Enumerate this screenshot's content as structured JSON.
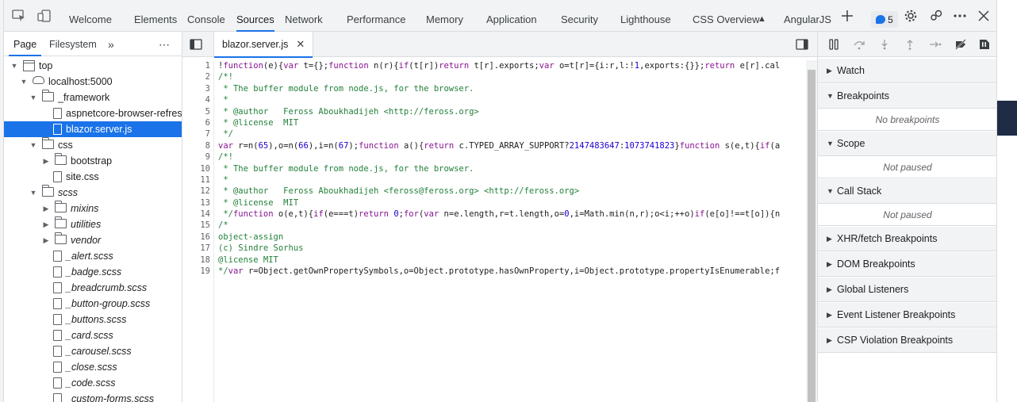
{
  "toolbar": {
    "tabs": [
      "Welcome",
      "Elements",
      "Console",
      "Sources",
      "Network",
      "Performance",
      "Memory",
      "Application",
      "Security",
      "Lighthouse",
      "CSS Overview",
      "AngularJS"
    ],
    "selected_tab": "Sources",
    "issues_count": "5",
    "accent": "#1a73e8"
  },
  "navigator": {
    "tabs": [
      "Page",
      "Filesystem"
    ],
    "selected_tab": "Page",
    "tree": [
      {
        "label": "top",
        "depth": 0,
        "kind": "frame",
        "expanded": true
      },
      {
        "label": "localhost:5000",
        "depth": 1,
        "kind": "cloud",
        "expanded": true
      },
      {
        "label": "_framework",
        "depth": 2,
        "kind": "folder",
        "expanded": true
      },
      {
        "label": "aspnetcore-browser-refresh",
        "depth": 3,
        "kind": "file"
      },
      {
        "label": "blazor.server.js",
        "depth": 3,
        "kind": "file",
        "selected": true
      },
      {
        "label": "css",
        "depth": 2,
        "kind": "folder",
        "expanded": true
      },
      {
        "label": "bootstrap",
        "depth": 3,
        "kind": "folder",
        "expanded": false
      },
      {
        "label": "site.css",
        "depth": 3,
        "kind": "file"
      },
      {
        "label": "scss",
        "depth": 2,
        "kind": "folder",
        "expanded": true,
        "italic": true
      },
      {
        "label": "mixins",
        "depth": 3,
        "kind": "folder",
        "expanded": false,
        "italic": true
      },
      {
        "label": "utilities",
        "depth": 3,
        "kind": "folder",
        "expanded": false,
        "italic": true
      },
      {
        "label": "vendor",
        "depth": 3,
        "kind": "folder",
        "expanded": false,
        "italic": true
      },
      {
        "label": "_alert.scss",
        "depth": 3,
        "kind": "file",
        "italic": true
      },
      {
        "label": "_badge.scss",
        "depth": 3,
        "kind": "file",
        "italic": true
      },
      {
        "label": "_breadcrumb.scss",
        "depth": 3,
        "kind": "file",
        "italic": true
      },
      {
        "label": "_button-group.scss",
        "depth": 3,
        "kind": "file",
        "italic": true
      },
      {
        "label": "_buttons.scss",
        "depth": 3,
        "kind": "file",
        "italic": true
      },
      {
        "label": "_card.scss",
        "depth": 3,
        "kind": "file",
        "italic": true
      },
      {
        "label": "_carousel.scss",
        "depth": 3,
        "kind": "file",
        "italic": true
      },
      {
        "label": "_close.scss",
        "depth": 3,
        "kind": "file",
        "italic": true
      },
      {
        "label": "_code.scss",
        "depth": 3,
        "kind": "file",
        "italic": true
      },
      {
        "label": "_custom-forms.scss",
        "depth": 3,
        "kind": "file",
        "italic": true
      }
    ]
  },
  "editor": {
    "open_file": "blazor.server.js",
    "lines": [
      [
        {
          "t": "!",
          "c": ""
        },
        {
          "t": "function",
          "c": "kw"
        },
        {
          "t": "(e){",
          "c": ""
        },
        {
          "t": "var",
          "c": "kw"
        },
        {
          "t": " t={};",
          "c": ""
        },
        {
          "t": "function",
          "c": "kw"
        },
        {
          "t": " n(r){",
          "c": ""
        },
        {
          "t": "if",
          "c": "kw"
        },
        {
          "t": "(t[r])",
          "c": ""
        },
        {
          "t": "return",
          "c": "kw"
        },
        {
          "t": " t[r].exports;",
          "c": ""
        },
        {
          "t": "var",
          "c": "kw"
        },
        {
          "t": " o=t[r]={i:r,l:!",
          "c": ""
        },
        {
          "t": "1",
          "c": "num"
        },
        {
          "t": ",exports:{}};",
          "c": ""
        },
        {
          "t": "return",
          "c": "kw"
        },
        {
          "t": " e[r].cal",
          "c": ""
        }
      ],
      [
        {
          "t": "/*!",
          "c": "com"
        }
      ],
      [
        {
          "t": " * The buffer module from node.js, for the browser.",
          "c": "com"
        }
      ],
      [
        {
          "t": " *",
          "c": "com"
        }
      ],
      [
        {
          "t": " * @author   Feross Aboukhadijeh <http://feross.org>",
          "c": "com"
        }
      ],
      [
        {
          "t": " * @license  MIT",
          "c": "com"
        }
      ],
      [
        {
          "t": " */",
          "c": "com"
        }
      ],
      [
        {
          "t": "var",
          "c": "kw"
        },
        {
          "t": " r=n(",
          "c": ""
        },
        {
          "t": "65",
          "c": "num"
        },
        {
          "t": "),o=n(",
          "c": ""
        },
        {
          "t": "66",
          "c": "num"
        },
        {
          "t": "),i=n(",
          "c": ""
        },
        {
          "t": "67",
          "c": "num"
        },
        {
          "t": ");",
          "c": ""
        },
        {
          "t": "function",
          "c": "kw"
        },
        {
          "t": " a(){",
          "c": ""
        },
        {
          "t": "return",
          "c": "kw"
        },
        {
          "t": " c.TYPED_ARRAY_SUPPORT?",
          "c": ""
        },
        {
          "t": "2147483647",
          "c": "num"
        },
        {
          "t": ":",
          "c": ""
        },
        {
          "t": "1073741823",
          "c": "num"
        },
        {
          "t": "}",
          "c": ""
        },
        {
          "t": "function",
          "c": "kw"
        },
        {
          "t": " s(e,t){",
          "c": ""
        },
        {
          "t": "if",
          "c": "kw"
        },
        {
          "t": "(a",
          "c": ""
        }
      ],
      [
        {
          "t": "/*!",
          "c": "com"
        }
      ],
      [
        {
          "t": " * The buffer module from node.js, for the browser.",
          "c": "com"
        }
      ],
      [
        {
          "t": " *",
          "c": "com"
        }
      ],
      [
        {
          "t": " * @author   Feross Aboukhadijeh <feross@feross.org> <http://feross.org>",
          "c": "com"
        }
      ],
      [
        {
          "t": " * @license  MIT",
          "c": "com"
        }
      ],
      [
        {
          "t": " */",
          "c": "com"
        },
        {
          "t": "function",
          "c": "kw"
        },
        {
          "t": " o(e,t){",
          "c": ""
        },
        {
          "t": "if",
          "c": "kw"
        },
        {
          "t": "(e===t)",
          "c": ""
        },
        {
          "t": "return",
          "c": "kw"
        },
        {
          "t": " ",
          "c": ""
        },
        {
          "t": "0",
          "c": "num"
        },
        {
          "t": ";",
          "c": ""
        },
        {
          "t": "for",
          "c": "kw"
        },
        {
          "t": "(",
          "c": ""
        },
        {
          "t": "var",
          "c": "kw"
        },
        {
          "t": " n=e.length,r=t.length,o=",
          "c": ""
        },
        {
          "t": "0",
          "c": "num"
        },
        {
          "t": ",i=Math.min(n,r);o<i;++o)",
          "c": ""
        },
        {
          "t": "if",
          "c": "kw"
        },
        {
          "t": "(e[o]!==t[o]){n",
          "c": ""
        }
      ],
      [
        {
          "t": "/*",
          "c": "com"
        }
      ],
      [
        {
          "t": "object-assign",
          "c": "com"
        }
      ],
      [
        {
          "t": "(c) Sindre Sorhus",
          "c": "com"
        }
      ],
      [
        {
          "t": "@license MIT",
          "c": "com"
        }
      ],
      [
        {
          "t": "*/",
          "c": "com"
        },
        {
          "t": "var",
          "c": "kw"
        },
        {
          "t": " r=Object.getOwnPropertySymbols,o=Object.prototype.hasOwnProperty,i=Object.prototype.propertyIsEnumerable;f",
          "c": ""
        }
      ]
    ]
  },
  "debugger": {
    "sections": [
      {
        "title": "Watch",
        "expanded": false
      },
      {
        "title": "Breakpoints",
        "expanded": true,
        "body": "No breakpoints"
      },
      {
        "title": "Scope",
        "expanded": true,
        "body": "Not paused"
      },
      {
        "title": "Call Stack",
        "expanded": true,
        "body": "Not paused"
      },
      {
        "title": "XHR/fetch Breakpoints",
        "expanded": false
      },
      {
        "title": "DOM Breakpoints",
        "expanded": false
      },
      {
        "title": "Global Listeners",
        "expanded": false
      },
      {
        "title": "Event Listener Breakpoints",
        "expanded": false
      },
      {
        "title": "CSP Violation Breakpoints",
        "expanded": false
      }
    ]
  }
}
